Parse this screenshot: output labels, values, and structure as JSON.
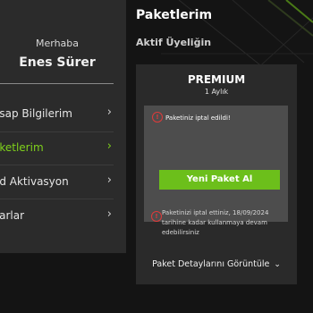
{
  "sidebar": {
    "greeting": "Merhaba",
    "user_name": "Enes Sürer",
    "items": [
      {
        "label": "esap Bilgilerim",
        "active": false
      },
      {
        "label": "aketlerim",
        "active": true
      },
      {
        "label": "od Aktivasyon",
        "active": false
      },
      {
        "label": "varlar",
        "active": false
      }
    ],
    "chevron": "›"
  },
  "main": {
    "title": "Paketlerim",
    "subtitle": "Aktif Üyeliğin"
  },
  "card": {
    "plan_name": "PREMIUM",
    "plan_duration": "1 Aylık",
    "cancel_message": "Paketiniz iptal edildi!",
    "new_package_button": "Yeni Paket Al",
    "info_text": "Paketinizi iptal ettiniz, 18/09/2024 tarihine kadar kullanmaya devam edebilirsiniz",
    "details_link": "Paket Detaylarını Görüntüle",
    "alert_icon_glyph": "!",
    "chevron_down": "⌄"
  },
  "colors": {
    "accent_green": "#7fd11b",
    "button_green": "#6cbf1b",
    "alert_red": "#e03a3a"
  }
}
